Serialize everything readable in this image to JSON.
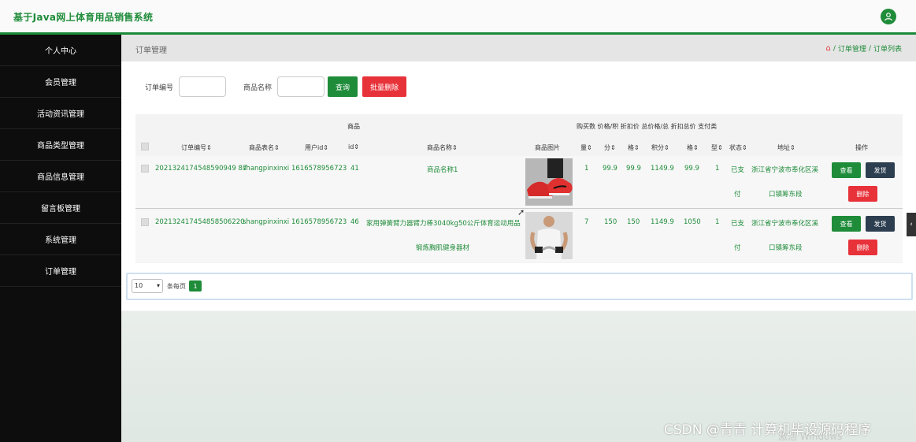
{
  "app": {
    "title": "基于Java网上体育用品销售系统"
  },
  "colors": {
    "brand": "#1f8c3a",
    "danger": "#e8323a",
    "dark": "#2c3e50",
    "sidebar": "#0d0d0d"
  },
  "sidebar": {
    "items": [
      {
        "label": "个人中心"
      },
      {
        "label": "会员管理"
      },
      {
        "label": "活动资讯管理"
      },
      {
        "label": "商品类型管理"
      },
      {
        "label": "商品信息管理"
      },
      {
        "label": "留言板管理"
      },
      {
        "label": "系统管理"
      },
      {
        "label": "订单管理"
      }
    ]
  },
  "header": {
    "page_title": "订单管理",
    "breadcrumb": [
      "订单管理",
      "订单列表"
    ],
    "sep": "/"
  },
  "search": {
    "order_no_label": "订单编号",
    "product_name_label": "商品名称",
    "query_button": "查询",
    "batch_delete_button": "批量删除"
  },
  "table": {
    "group_headers": {
      "product": "商品",
      "right": "购买数 价格/积 折扣价 总价格/总 折扣总价 支付类"
    },
    "columns": [
      "订单编号⇕",
      "商品表名⇕",
      "用户id⇕",
      "id⇕",
      "商品名称⇕",
      "商品图片",
      "量⇕",
      "分⇕",
      "格⇕",
      "积分⇕",
      "格⇕",
      "型⇕",
      "状态⇕",
      "地址⇕",
      "操作"
    ],
    "rows": [
      {
        "order_no": "20213241745485909498 7",
        "order_no_display": "2021324174548590949 87",
        "table_name": "shangpinxinxi",
        "user_id": "1616578956723",
        "id": "41",
        "product_name": "商品名称1",
        "qty": "1",
        "price": "99.9",
        "discount": "99.9",
        "total": "1149.9",
        "discount_total": "99.9",
        "pay_type": "1",
        "status_a": "已支",
        "status_b": "付",
        "addr_a": "浙江省宁波市奉化区溪",
        "addr_b": "口镇筹东段"
      },
      {
        "order_no": "202132417454858506220",
        "table_name": "shangpinxinxi",
        "user_id": "1616578956723",
        "id": "46",
        "product_name_a": "家用弹簧臂力器臂力棒3040kg50公斤体育运动用品",
        "product_name_b": "锻炼胸肌健身器材",
        "qty": "7",
        "price": "150",
        "discount": "150",
        "total": "1149.9",
        "discount_total": "1050",
        "pay_type": "1",
        "status_a": "已支",
        "status_b": "付",
        "addr_a": "浙江省宁波市奉化区溪",
        "addr_b": "口镇筹东段"
      }
    ],
    "actions": {
      "view": "查看",
      "ship": "发货",
      "delete": "删除"
    }
  },
  "pager": {
    "page_size": "10",
    "per_page_label": "条每页",
    "current_page": "1"
  },
  "overlay": {
    "watermark": "CSDN @青青  计算机毕设源码程序",
    "windows": "激活 Windows"
  },
  "icons": [
    "user-icon",
    "home-icon",
    "chevron-down-icon",
    "chevron-left-icon",
    "cursor-icon"
  ]
}
